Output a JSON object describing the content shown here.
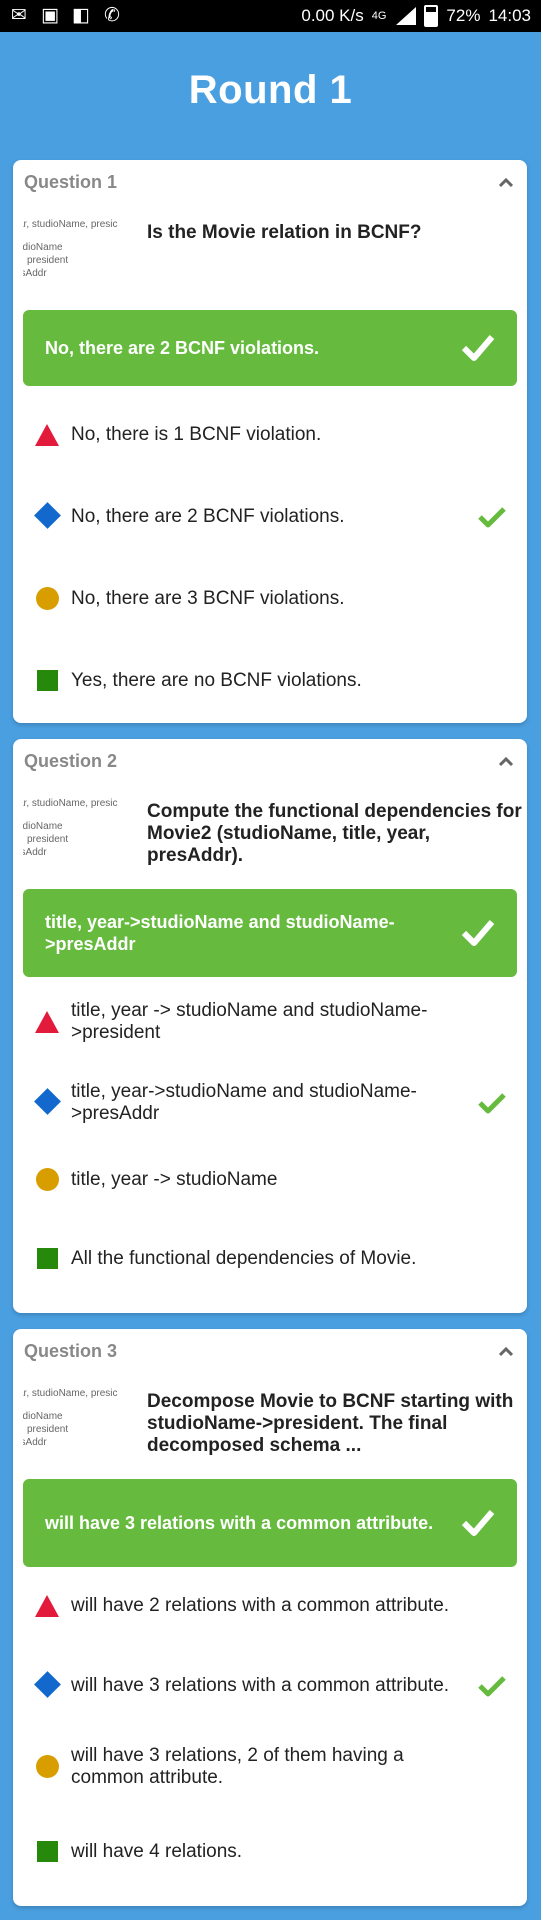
{
  "status_bar": {
    "speed": "0.00 K/s",
    "network": "4G",
    "battery": "72%",
    "time": "14:03",
    "icons": [
      "gmail-icon",
      "image-icon",
      "image-location-icon",
      "whatsapp-icon"
    ]
  },
  "round_title": "Round 1",
  "colors": {
    "background": "#4a9fe0",
    "correct": "#66bb3f",
    "triangle": "#e21b3c",
    "diamond": "#1368ce",
    "circle": "#d89e00",
    "square": "#26890c"
  },
  "thumbnail": {
    "line1": "ar, studioName, presic",
    "line2": "udioName",
    "line3": "president",
    "line4": "esAddr"
  },
  "questions": [
    {
      "label": "Question 1",
      "text": "Is the Movie relation in BCNF?",
      "correct": "No, there are 2 BCNF violations.",
      "options": [
        "No, there is 1 BCNF violation.",
        "No, there are 2 BCNF violations.",
        "No, there are 3 BCNF violations.",
        "Yes, there are no BCNF violations."
      ],
      "correct_index": 1
    },
    {
      "label": "Question 2",
      "text": "Compute the functional dependencies for Movie2 (studioName, title, year, presAddr).",
      "correct": "title, year->studioName and studioName->presAddr",
      "options": [
        "title, year -> studioName and studioName->president",
        "title, year->studioName and studioName->presAddr",
        "title, year -> studioName",
        "All the functional dependencies of Movie."
      ],
      "correct_index": 1
    },
    {
      "label": "Question 3",
      "text": "Decompose Movie to BCNF starting with studioName->president. The final decomposed schema ...",
      "correct": "will have 3 relations with a common attribute.",
      "options": [
        "will have 2 relations with a common attribute.",
        "will have 3 relations with a common attribute.",
        "will have 3 relations, 2 of them having a common attribute.",
        "will have 4 relations."
      ],
      "correct_index": 1
    }
  ]
}
